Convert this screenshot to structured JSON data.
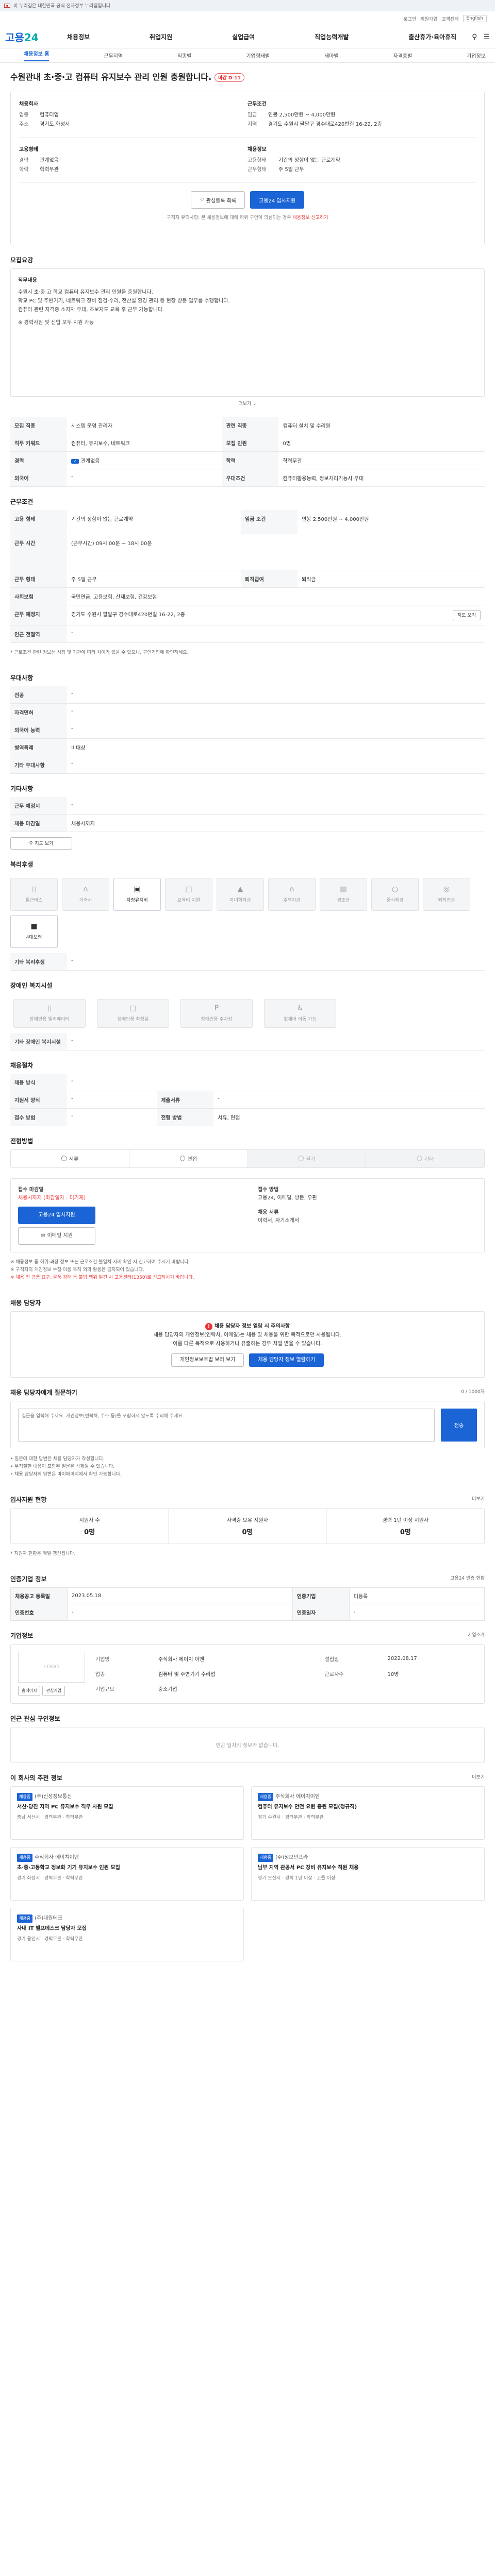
{
  "topbar": {
    "notice": "이 누리집은 대한민국 공식 전자정부 누리집입니다."
  },
  "gnb_top": {
    "links": [
      "로그인",
      "회원가입",
      "고객센터"
    ],
    "lang": "English"
  },
  "logo": {
    "main": "고용",
    "sub": "24"
  },
  "menu": [
    "채용정보",
    "취업지원",
    "실업급여",
    "직업능력개발",
    "출산휴가·육아휴직"
  ],
  "subnav": {
    "items": [
      "채용정보 홈",
      "근무지역",
      "직종별",
      "기업형태별",
      "테마별",
      "자격증별",
      "기업정보"
    ],
    "active": 0
  },
  "title": "수원관내 초·중·고 컴퓨터 유지보수 관리 인원 충원합니다.",
  "title_badge": "마감 D-11",
  "summary": {
    "company_label": "채용회사",
    "company": [
      [
        "업종",
        "컴퓨터업"
      ],
      [
        "주소",
        "경기도 화성시"
      ]
    ],
    "cond_label": "근무조건",
    "cond": [
      [
        "임금",
        "연봉 2,500만원 ~ 4,000만원"
      ],
      [
        "지역",
        "경기도 수원시 팔달구 경수대로420번길 16-22, 2층"
      ]
    ],
    "career_label": "고용형태",
    "career": [
      [
        "경력",
        "관계없음"
      ],
      [
        "학력",
        "학력무관"
      ]
    ],
    "emp_label": "채용정보",
    "emp": [
      [
        "고용형태",
        "기간의 정함이 없는 근로계약"
      ],
      [
        "근무형태",
        "주 5일 근무"
      ]
    ],
    "save_btn": "관심등록 회록",
    "apply_btn": "고용24 입사지원",
    "note_pre": "구직자 유의사항: 본 채용정보에 대해 허위 구인이 의심되는 경우",
    "note_red": "채용정보 신고하기"
  },
  "duties": {
    "heading": "모집요강",
    "sub": "직무내용",
    "text1": "수원시 초·중·고 학교 컴퓨터 유지보수 관리 인원을 충원합니다.",
    "text2": "학교 PC 및 주변기기, 네트워크 장비 점검·수리, 전산실 환경 관리 등 현장 방문 업무를 수행합니다.",
    "text3": "컴퓨터 관련 자격증 소지자 우대, 초보자도 교육 후 근무 가능합니다.",
    "text4": "※ 경력사원 및 신입 모두 지원 가능",
    "more": "더보기"
  },
  "recruit_table": [
    [
      "모집 직종",
      "시스템 운영 관리자"
    ],
    [
      "관련 직종",
      "컴퓨터 설치 및 수리원"
    ],
    [
      "직무 키워드",
      "컴퓨터, 유지보수, 네트워크"
    ],
    [
      "모집 인원",
      "0명"
    ],
    [
      "경력",
      "관계없음"
    ],
    [
      "학력",
      "학력무관"
    ],
    [
      "외국어",
      "-"
    ],
    [
      "우대조건",
      "컴퓨터활용능력, 정보처리기능사 우대"
    ]
  ],
  "work": {
    "heading": "근무조건",
    "rows": [
      [
        "고용 형태",
        "기간의 정함이 없는 근로계약"
      ],
      [
        "임금 조건",
        "연봉 2,500만원 ~ 4,000만원"
      ],
      [
        "근무 시간",
        "(근무시간) 09시 00분 ~ 18시 00분"
      ],
      [
        "근무 형태",
        "주 5일 근무"
      ],
      [
        "사회보험",
        "국민연금, 고용보험, 산재보험, 건강보험"
      ],
      [
        "퇴직급여",
        "퇴직금"
      ],
      [
        "근무 예정지",
        "경기도 수원시 팔달구 경수대로420번길 16-22, 2층"
      ],
      [
        "인근 전철역",
        "-"
      ]
    ],
    "note": "* 근로조건 관련 정보는 시점 및 기관에 따라 차이가 있을 수 있으니, 구인기업에 확인하세요."
  },
  "welfare": {
    "heading": "우대사항",
    "rows": [
      [
        "전공",
        "-"
      ],
      [
        "자격면허",
        "-"
      ],
      [
        "외국어 능력",
        "-"
      ],
      [
        "병역특례",
        "비대상"
      ],
      [
        "기타 우대사항",
        "-"
      ]
    ]
  },
  "other": {
    "heading": "기타사항",
    "rows": [
      [
        "근무 예정지",
        "-"
      ],
      [
        "채용 마감일",
        "채용시까지"
      ]
    ],
    "map_btn": "지도 보기"
  },
  "benefits": {
    "heading": "복리후생",
    "items": [
      "통근버스",
      "기숙사",
      "차량유지비",
      "교육비 지원",
      "자녀학자금",
      "주택자금",
      "경조금",
      "중식제공",
      "퇴직연금",
      "4대보험"
    ],
    "etc_label": "기타 복리후생",
    "etc": "-"
  },
  "disability": {
    "heading": "장애인 복지시설",
    "items": [
      "장애인용 엘리베이터",
      "장애인용 화장실",
      "장애인용 주차장",
      "휠체어 이동 가능"
    ],
    "etc_label": "기타 장애인 복지시설",
    "etc": "-"
  },
  "emp_info": {
    "heading": "채용절차",
    "rows": [
      [
        "채용 방식",
        "-",
        "",
        ""
      ],
      [
        "지원서 양식",
        "-",
        "제출서류",
        "-"
      ],
      [
        "접수 방법",
        "-",
        "전형 방법",
        "서류, 면접"
      ]
    ]
  },
  "tabs": {
    "heading": "전형방법",
    "items": [
      "서류",
      "면접",
      "필기",
      "기타"
    ],
    "disabled": [
      false,
      false,
      true,
      true
    ]
  },
  "apply": {
    "label_a": "접수 마감일",
    "deadline": "채용시까지 (마감일자 : 미기재)",
    "apply_btn": "고용24 입사지원",
    "email_btn": "이메일 지원",
    "label_b": "접수 방법",
    "methods": [
      "고용24",
      "이메일",
      "방문",
      "우편"
    ],
    "contact_label": "채용 서류",
    "contact": "이력서, 자기소개서"
  },
  "cautions": [
    "※ 채용정보 중 허위·과장 정보 또는 근로조건 불일치 사례 확인 시 신고하여 주시기 바랍니다.",
    "※ 구직자의 개인정보 수집·이용 목적 외의 활용은 금지되어 있습니다.",
    "※ 채용 전 금품 요구, 물품 강매 등 불법 행위 발견 시 고용센터(1350)로 신고하시기 바랍니다."
  ],
  "manager": {
    "heading": "채용 담당자",
    "title": "채용 담당자 정보 열람 시 주의사항",
    "line1": "채용 담당자의 개인정보(연락처, 이메일)는 채용 및 채용을 위한 목적으로만 사용됩니다.",
    "line2": "이를 다른 목적으로 사용하거나 유출하는 경우 처벌 받을 수 있습니다.",
    "btn1": "개인정보보호법 보러 보기",
    "btn2": "채용 담당자 정보 열람하기"
  },
  "qa": {
    "heading": "채용 담당자에게 질문하기",
    "right": "0 / 1000자",
    "placeholder": "질문을 입력해 주세요. 개인정보(연락처, 주소 등)를 포함하지 않도록 주의해 주세요.",
    "send": "전송",
    "notes": [
      "• 질문에 대한 답변은 채용 담당자가 작성합니다.",
      "• 부적절한 내용이 포함된 질문은 삭제될 수 있습니다.",
      "• 채용 담당자의 답변은 마이페이지에서 확인 가능합니다."
    ]
  },
  "stats": {
    "heading": "입사지원 현황",
    "more": "더보기",
    "items": [
      [
        "지원자 수",
        "0명"
      ],
      [
        "자격증 보유 지원자",
        "0명"
      ],
      [
        "경력 1년 이상 지원자",
        "0명"
      ]
    ],
    "note": "* 지원자 현황은 매일 갱신됩니다."
  },
  "job_info": {
    "heading": "인증기업 정보",
    "right": "고용24 인증 현황",
    "rows": [
      [
        "채용공고 등록일",
        "2023.05.18",
        "인증기업",
        "미등록"
      ],
      [
        "인증번호",
        "-",
        "인증일자",
        "-"
      ]
    ]
  },
  "company": {
    "heading": "기업정보",
    "more": "기업소개",
    "logo_text": "LOGO",
    "rows": [
      [
        "기업명",
        "주식회사 에이치 이엔",
        "설립일",
        "2022.08.17"
      ],
      [
        "업종",
        "컴퓨터 및 주변기기 수리업",
        "근로자수",
        "10명"
      ],
      [
        "기업규모",
        "중소기업",
        "",
        ""
      ]
    ],
    "btn1": "홈페이지",
    "btn2": "관심기업"
  },
  "other_jobs": {
    "heading": "인근 관심 구인정보",
    "empty": "인근 일자리 정보가 없습니다."
  },
  "related": {
    "heading": "이 회사의 추천 정보",
    "more": "더보기",
    "jobs": [
      {
        "tag": "채용중",
        "co": "(주)신성정보통신",
        "title": "서산·당진 지역 PC 유지보수 직무 사원 모집",
        "meta": "충남 서산시 · 경력무관 · 학력무관"
      },
      {
        "tag": "채용중",
        "co": "주식회사 에이치이엔",
        "title": "컴퓨터 유지보수 안전 요원 충원 모집(정규직)",
        "meta": "경기 수원시 · 경력무관 · 학력무관"
      },
      {
        "tag": "채용중",
        "co": "주식회사 에이치이엔",
        "title": "초·중·고등학교 정보화 기기 유지보수 인원 모집",
        "meta": "경기 화성시 · 경력무관 · 학력무관"
      },
      {
        "tag": "채용중",
        "co": "(주)정보인프라",
        "title": "남부 지역 관공서 PC 장비 유지보수 직원 채용",
        "meta": "경기 오산시 · 경력 1년 이상 · 고졸 이상"
      },
      {
        "tag": "채용중",
        "co": "(주)대원테크",
        "title": "사내 IT 헬프데스크 담당자 모집",
        "meta": "경기 용인시 · 경력무관 · 학력무관"
      }
    ]
  }
}
